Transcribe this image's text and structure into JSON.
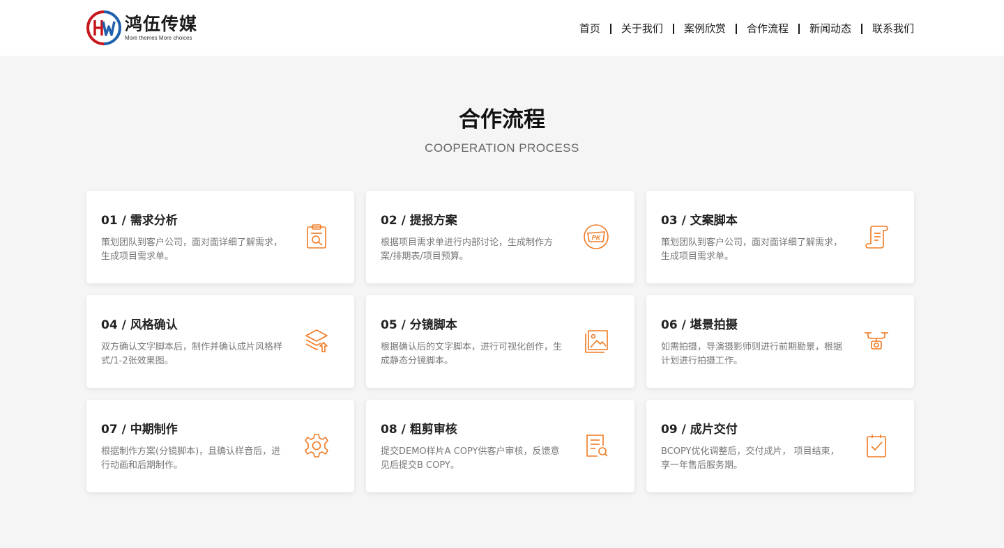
{
  "header": {
    "logo_name": "鸿伍传媒",
    "logo_slogan": "More themes More choices",
    "nav": [
      "首页",
      "关于我们",
      "案例欣赏",
      "合作流程",
      "新闻动态",
      "联系我们"
    ]
  },
  "section": {
    "title": "合作流程",
    "subtitle": "COOPERATION PROCESS"
  },
  "colors": {
    "accent": "#f07a22",
    "logo_red": "#c8161d",
    "logo_blue": "#1f5fab"
  },
  "cards": [
    {
      "title": "01 / 需求分析",
      "desc": "策划团队到客户公司，面对面详细了解需求，生成项目需求单。",
      "icon": "clipboard-search-icon"
    },
    {
      "title": "02 / 提报方案",
      "desc": "根据项目需求单进行内部讨论，生成制作方案/排期表/项目预算。",
      "icon": "pk-icon"
    },
    {
      "title": "03 / 文案脚本",
      "desc": "策划团队到客户公司，面对面详细了解需求，生成项目需求单。",
      "icon": "scroll-icon"
    },
    {
      "title": "04 / 风格确认",
      "desc": "双方确认文字脚本后，制作并确认成片风格样式/1-2张效果图。",
      "icon": "layers-upload-icon"
    },
    {
      "title": "05 / 分镜脚本",
      "desc": "根据确认后的文字脚本，进行可视化创作，生成静态分镜脚本。",
      "icon": "image-icon"
    },
    {
      "title": "06 / 堪景拍摄",
      "desc": "如需拍摄，导演摄影师则进行前期勘景，根据计划进行拍摄工作。",
      "icon": "drone-icon"
    },
    {
      "title": "07 / 中期制作",
      "desc": "根据制作方案(分镜脚本)，且确认样音后，进行动画和后期制作。",
      "icon": "gear-icon"
    },
    {
      "title": "08 / 粗剪审核",
      "desc": "提交DEMO样片A COPY供客户审核，反馈意见后提交B COPY。",
      "icon": "document-search-icon"
    },
    {
      "title": "09 / 成片交付",
      "desc": "BCOPY优化调整后，交付成片， 项目结束，享一年售后服务期。",
      "icon": "clipboard-check-icon"
    }
  ]
}
